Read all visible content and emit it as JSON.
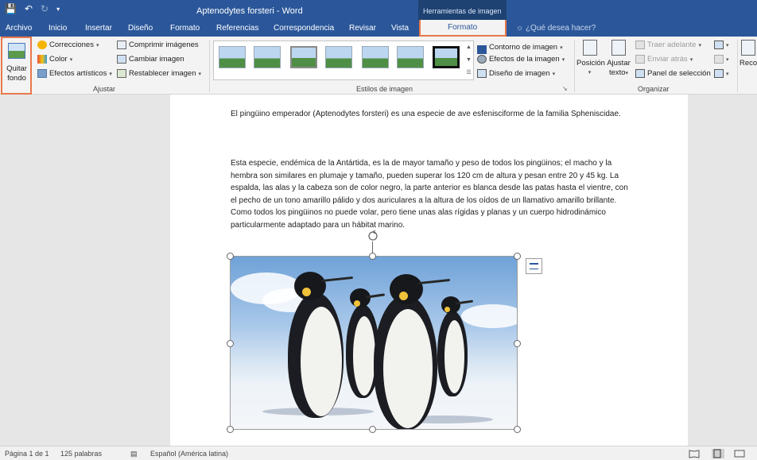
{
  "window": {
    "title": "Aptenodytes forsteri - Word",
    "contextual_tab_group": "Herramientas de imagen"
  },
  "tabs": [
    "Archivo",
    "Inicio",
    "Insertar",
    "Diseño",
    "Formato",
    "Referencias",
    "Correspondencia",
    "Revisar",
    "Vista"
  ],
  "active_tab": "Formato",
  "tell_me": "¿Qué desea hacer?",
  "ribbon": {
    "ajustar": {
      "label": "Ajustar",
      "remove_bg_line1": "Quitar",
      "remove_bg_line2": "fondo",
      "corrections": "Correcciones",
      "color": "Color",
      "artistic": "Efectos artísticos",
      "compress": "Comprimir imágenes",
      "change": "Cambiar imagen",
      "reset": "Restablecer imagen"
    },
    "estilos": {
      "label": "Estilos de imagen",
      "border": "Contorno de imagen",
      "effects": "Efectos de la imagen",
      "layout": "Diseño de imagen"
    },
    "organizar": {
      "label": "Organizar",
      "position": "Posición",
      "wrap_line1": "Ajustar",
      "wrap_line2": "texto",
      "bring_forward": "Traer adelante",
      "send_backward": "Enviar atrás",
      "selection_pane": "Panel de selección",
      "crop": "Reco"
    }
  },
  "document": {
    "p1": "El pingüino emperador (Aptenodytes forsteri) es una especie de ave esfenisciforme de la familia Spheniscidae.",
    "p2": "Esta especie, endémica de la Antártida, es la de mayor tamaño y peso de todos los pingüinos; el macho y la hembra son similares en plumaje y tamaño, pueden superar los 120 cm de altura y pesan entre 20 y 45 kg. La espalda, las alas y la cabeza son de color negro, la parte anterior es blanca desde las patas hasta el vientre, con el pecho de un tono amarillo pálido y dos auriculares a la altura de los oídos de un llamativo amarillo brillante. Como todos los pingüinos no puede volar, pero tiene unas alas rígidas y planas y un cuerpo hidrodinámico particularmente adaptado para un hábitat marino."
  },
  "status": {
    "page": "Página 1 de 1",
    "words": "125 palabras",
    "language": "Español (América latina)"
  },
  "colors": {
    "accent": "#2b579a",
    "highlight": "#e8784a"
  }
}
